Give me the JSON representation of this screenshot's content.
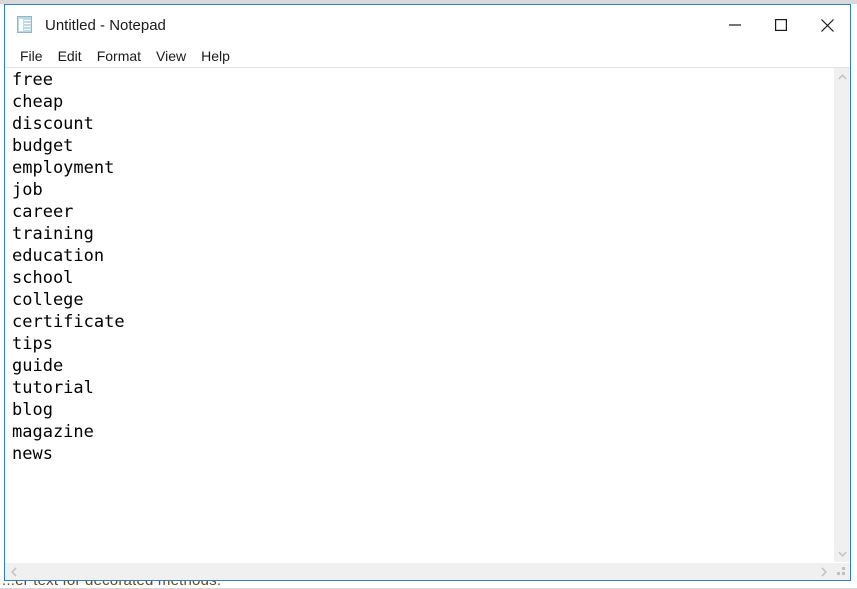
{
  "window": {
    "title": "Untitled - Notepad",
    "app_icon": "notepad-icon",
    "border_color": "#2f7fc4",
    "controls": [
      {
        "name": "minimize",
        "glyph": "minimize-icon"
      },
      {
        "name": "maximize",
        "glyph": "maximize-icon"
      },
      {
        "name": "close",
        "glyph": "close-icon"
      }
    ]
  },
  "menu": {
    "items": [
      {
        "label": "File"
      },
      {
        "label": "Edit"
      },
      {
        "label": "Format"
      },
      {
        "label": "View"
      },
      {
        "label": "Help"
      }
    ]
  },
  "editor": {
    "lines": [
      "free",
      "cheap",
      "discount",
      "budget",
      "employment",
      "job",
      "career",
      "training",
      "education",
      "school",
      "college",
      "certificate",
      "tips",
      "guide",
      "tutorial",
      "blog",
      "magazine",
      "news"
    ]
  },
  "scrollbars": {
    "vertical": {
      "up_arrow": "chevron-up-icon",
      "down_arrow": "chevron-down-icon"
    },
    "horizontal": {
      "left_arrow": "chevron-left-icon",
      "right_arrow": "chevron-right-icon"
    },
    "resize_grip": "resize-grip-icon"
  },
  "backdrop": {
    "clipped_text": "...er text for decorated methods."
  }
}
